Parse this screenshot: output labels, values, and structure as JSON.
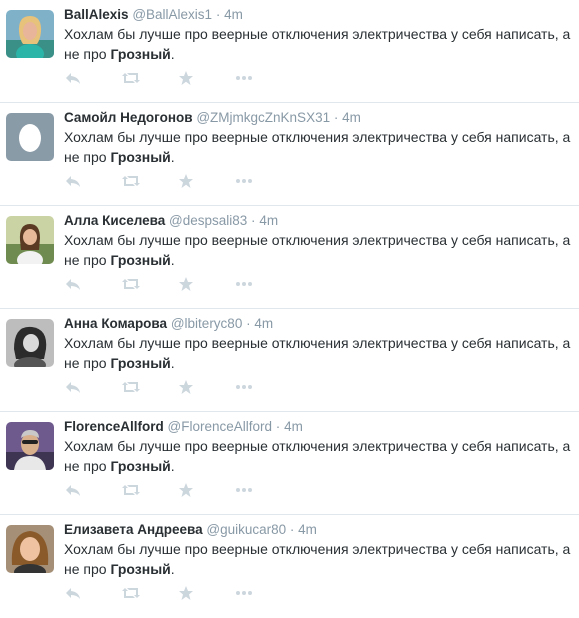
{
  "colors": {
    "name": "#292f33",
    "meta": "#8899a6",
    "action_icon": "#ccd6dd",
    "divider": "#e1e8ed"
  },
  "tweets": [
    {
      "name": "BallAlexis",
      "handle": "@BallAlexis1",
      "separator": "·",
      "time": "4m",
      "text_prefix": "Хохлам бы лучше про веерные отключения электричества у себя написать, а не про ",
      "text_bold": "Грозный",
      "text_suffix": ".",
      "avatar": "photo-woman-blonde"
    },
    {
      "name": "Самойл Недогонов",
      "handle": "@ZMjmkgcZnKnSX31",
      "separator": "·",
      "time": "4m",
      "text_prefix": "Хохлам бы лучше про веерные отключения электричества у себя написать, а не про ",
      "text_bold": "Грозный",
      "text_suffix": ".",
      "avatar": "default-egg"
    },
    {
      "name": "Алла Киселева",
      "handle": "@despsali83",
      "separator": "·",
      "time": "4m",
      "text_prefix": "Хохлам бы лучше про веерные отключения электричества у себя написать, а не про ",
      "text_bold": "Грозный",
      "text_suffix": ".",
      "avatar": "photo-woman-outdoor"
    },
    {
      "name": "Анна Комарова",
      "handle": "@lbiteryc80",
      "separator": "·",
      "time": "4m",
      "text_prefix": "Хохлам бы лучше про веерные отключения электричества у себя написать, а не про ",
      "text_bold": "Грозный",
      "text_suffix": ".",
      "avatar": "photo-woman-bw"
    },
    {
      "name": "FlorenceAllford",
      "handle": "@FlorenceAllford",
      "separator": "·",
      "time": "4m",
      "text_prefix": "Хохлам бы лучше про веерные отключения электричества у себя написать, а не про ",
      "text_bold": "Грозный",
      "text_suffix": ".",
      "avatar": "photo-man-purple"
    },
    {
      "name": "Елизавета Андреева",
      "handle": "@guikucar80",
      "separator": "·",
      "time": "4m",
      "text_prefix": "Хохлам бы лучше про веерные отключения электричества у себя написать, а не про ",
      "text_bold": "Грозный",
      "text_suffix": ".",
      "avatar": "photo-woman-portrait"
    }
  ],
  "actions": {
    "reply_icon": "reply-icon",
    "retweet_icon": "retweet-icon",
    "favorite_icon": "star-icon",
    "more_icon": "more-icon"
  }
}
